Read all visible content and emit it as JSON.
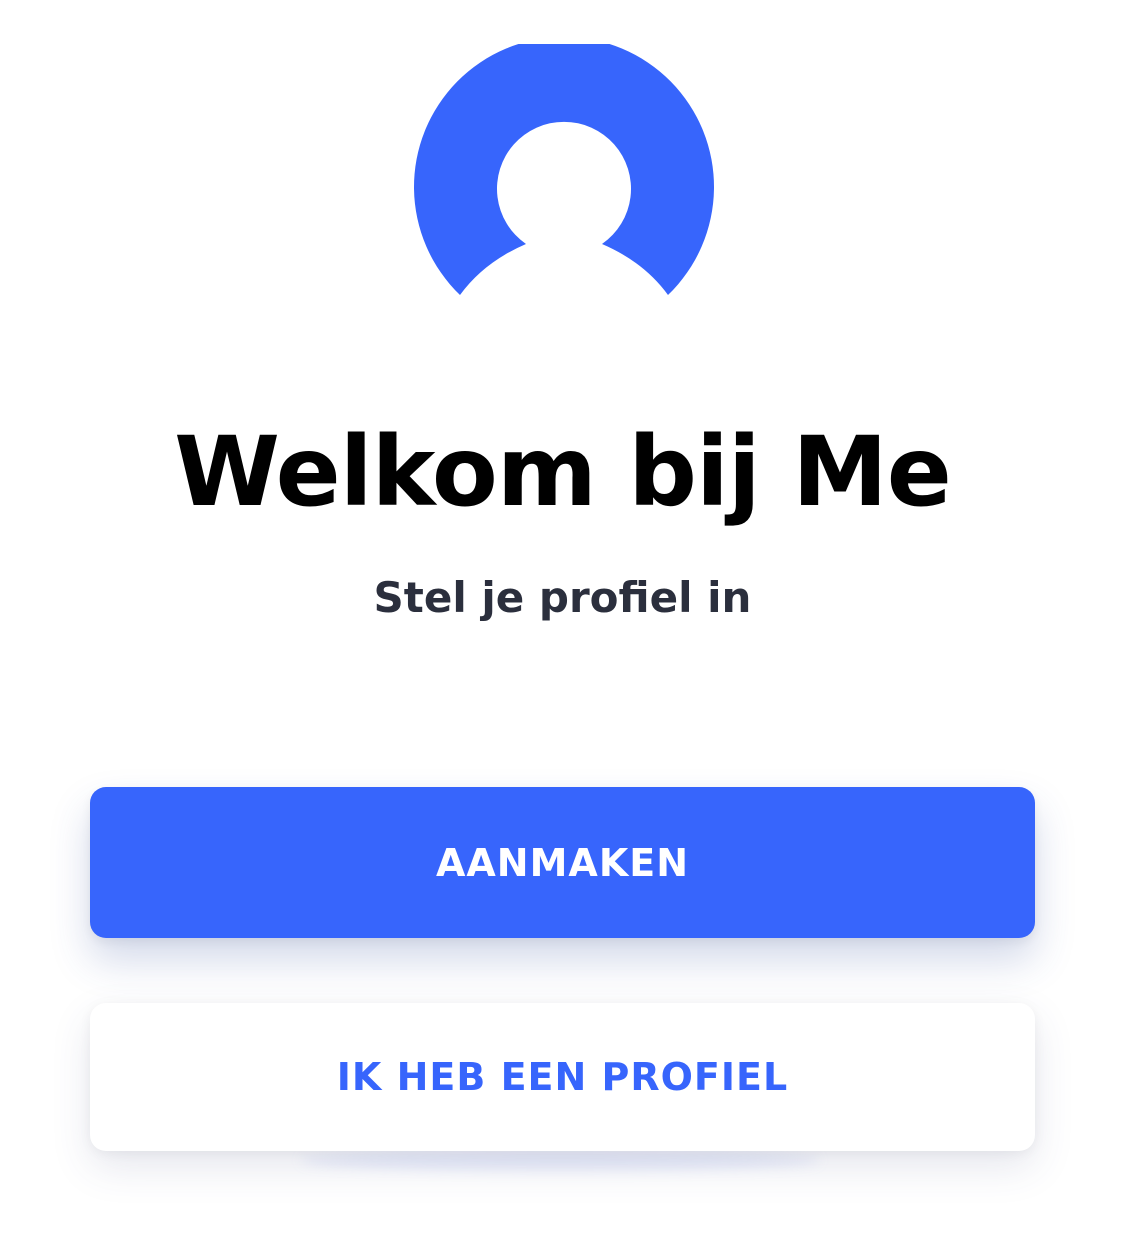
{
  "brand": {
    "logo_icon": "user-avatar-icon",
    "accent_color": "#3765fc"
  },
  "welcome": {
    "title": "Welkom bij Me",
    "subtitle": "Stel je profiel in"
  },
  "actions": {
    "create_label": "AANMAKEN",
    "login_label": "IK HEB EEN PROFIEL"
  }
}
